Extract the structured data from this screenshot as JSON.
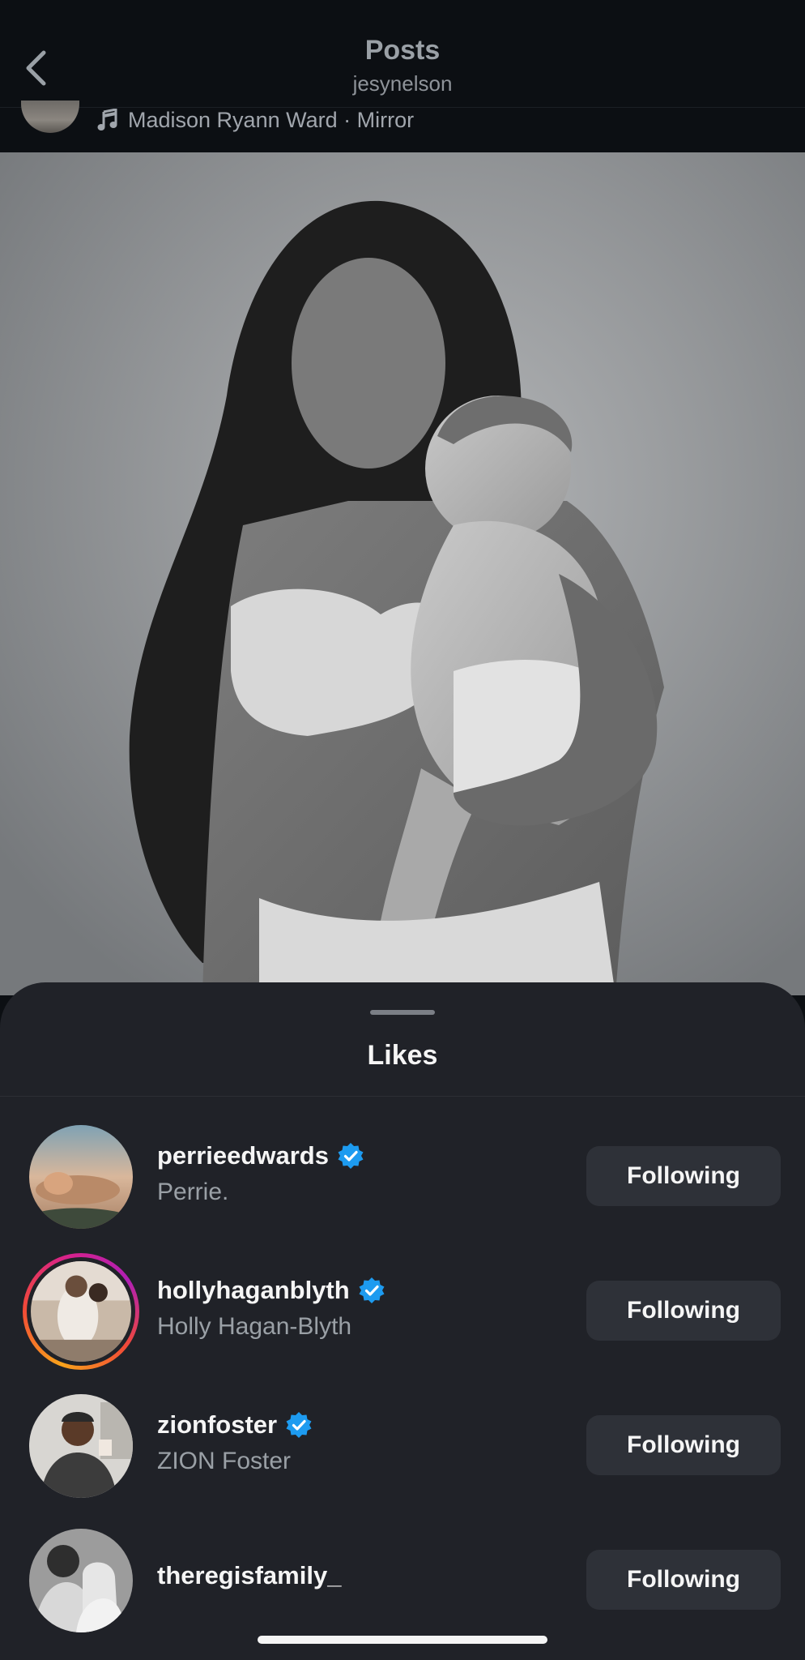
{
  "header": {
    "title": "Posts",
    "subtitle": "jesynelson",
    "back_icon": "chevron-left-icon"
  },
  "post": {
    "music_icon": "music-note-icon",
    "audio_label": "Madison Ryann Ward · Mirror"
  },
  "likes_sheet": {
    "title": "Likes",
    "users": [
      {
        "username": "perrieedwards",
        "full_name": "Perrie.",
        "verified": true,
        "story_ring": false,
        "button": "Following"
      },
      {
        "username": "hollyhaganblyth",
        "full_name": "Holly Hagan-Blyth",
        "verified": true,
        "story_ring": true,
        "button": "Following"
      },
      {
        "username": "zionfoster",
        "full_name": "ZION Foster",
        "verified": true,
        "story_ring": false,
        "button": "Following"
      },
      {
        "username": "theregisfamily_",
        "full_name": "",
        "verified": false,
        "story_ring": false,
        "button": "Following"
      }
    ]
  },
  "colors": {
    "background": "#0c0f13",
    "sheet": "#202228",
    "button": "#2e3138",
    "verified_blue": "#1d9bf0",
    "secondary_text": "#9aa0a6"
  }
}
